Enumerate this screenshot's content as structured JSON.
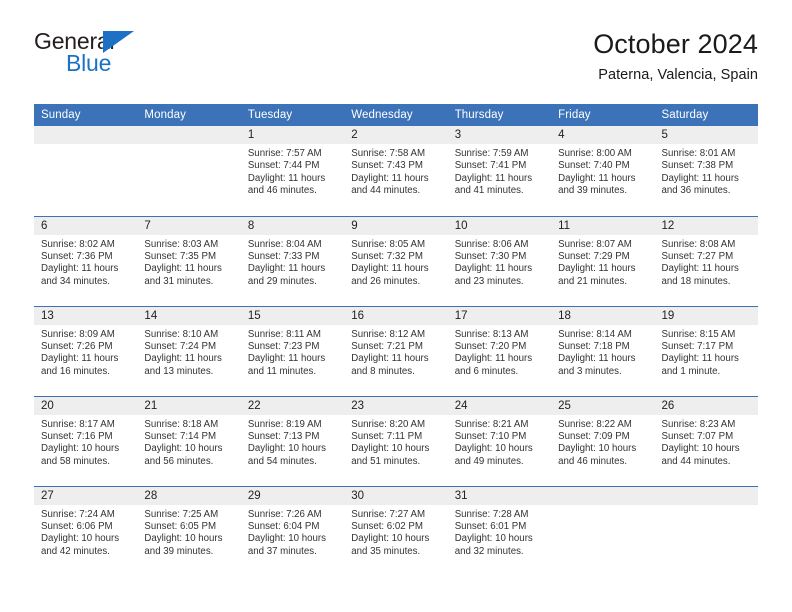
{
  "logo": {
    "word_primary": "General",
    "word_secondary": "Blue",
    "primary_color": "#231f20",
    "secondary_color": "#1c71c4"
  },
  "header": {
    "title": "October 2024",
    "subtitle": "Paterna, Valencia, Spain"
  },
  "theme": {
    "header_blue": "#3b72b8",
    "daynum_band": "#eeeeee",
    "text": "#333333"
  },
  "calendar": {
    "weekday_headers": [
      "Sunday",
      "Monday",
      "Tuesday",
      "Wednesday",
      "Thursday",
      "Friday",
      "Saturday"
    ],
    "weeks": [
      [
        {
          "day": "",
          "blank": true
        },
        {
          "day": "",
          "blank": true
        },
        {
          "day": "1",
          "sunrise": "Sunrise: 7:57 AM",
          "sunset": "Sunset: 7:44 PM",
          "daylight1": "Daylight: 11 hours",
          "daylight2": "and 46 minutes."
        },
        {
          "day": "2",
          "sunrise": "Sunrise: 7:58 AM",
          "sunset": "Sunset: 7:43 PM",
          "daylight1": "Daylight: 11 hours",
          "daylight2": "and 44 minutes."
        },
        {
          "day": "3",
          "sunrise": "Sunrise: 7:59 AM",
          "sunset": "Sunset: 7:41 PM",
          "daylight1": "Daylight: 11 hours",
          "daylight2": "and 41 minutes."
        },
        {
          "day": "4",
          "sunrise": "Sunrise: 8:00 AM",
          "sunset": "Sunset: 7:40 PM",
          "daylight1": "Daylight: 11 hours",
          "daylight2": "and 39 minutes."
        },
        {
          "day": "5",
          "sunrise": "Sunrise: 8:01 AM",
          "sunset": "Sunset: 7:38 PM",
          "daylight1": "Daylight: 11 hours",
          "daylight2": "and 36 minutes."
        }
      ],
      [
        {
          "day": "6",
          "sunrise": "Sunrise: 8:02 AM",
          "sunset": "Sunset: 7:36 PM",
          "daylight1": "Daylight: 11 hours",
          "daylight2": "and 34 minutes."
        },
        {
          "day": "7",
          "sunrise": "Sunrise: 8:03 AM",
          "sunset": "Sunset: 7:35 PM",
          "daylight1": "Daylight: 11 hours",
          "daylight2": "and 31 minutes."
        },
        {
          "day": "8",
          "sunrise": "Sunrise: 8:04 AM",
          "sunset": "Sunset: 7:33 PM",
          "daylight1": "Daylight: 11 hours",
          "daylight2": "and 29 minutes."
        },
        {
          "day": "9",
          "sunrise": "Sunrise: 8:05 AM",
          "sunset": "Sunset: 7:32 PM",
          "daylight1": "Daylight: 11 hours",
          "daylight2": "and 26 minutes."
        },
        {
          "day": "10",
          "sunrise": "Sunrise: 8:06 AM",
          "sunset": "Sunset: 7:30 PM",
          "daylight1": "Daylight: 11 hours",
          "daylight2": "and 23 minutes."
        },
        {
          "day": "11",
          "sunrise": "Sunrise: 8:07 AM",
          "sunset": "Sunset: 7:29 PM",
          "daylight1": "Daylight: 11 hours",
          "daylight2": "and 21 minutes."
        },
        {
          "day": "12",
          "sunrise": "Sunrise: 8:08 AM",
          "sunset": "Sunset: 7:27 PM",
          "daylight1": "Daylight: 11 hours",
          "daylight2": "and 18 minutes."
        }
      ],
      [
        {
          "day": "13",
          "sunrise": "Sunrise: 8:09 AM",
          "sunset": "Sunset: 7:26 PM",
          "daylight1": "Daylight: 11 hours",
          "daylight2": "and 16 minutes."
        },
        {
          "day": "14",
          "sunrise": "Sunrise: 8:10 AM",
          "sunset": "Sunset: 7:24 PM",
          "daylight1": "Daylight: 11 hours",
          "daylight2": "and 13 minutes."
        },
        {
          "day": "15",
          "sunrise": "Sunrise: 8:11 AM",
          "sunset": "Sunset: 7:23 PM",
          "daylight1": "Daylight: 11 hours",
          "daylight2": "and 11 minutes."
        },
        {
          "day": "16",
          "sunrise": "Sunrise: 8:12 AM",
          "sunset": "Sunset: 7:21 PM",
          "daylight1": "Daylight: 11 hours",
          "daylight2": "and 8 minutes."
        },
        {
          "day": "17",
          "sunrise": "Sunrise: 8:13 AM",
          "sunset": "Sunset: 7:20 PM",
          "daylight1": "Daylight: 11 hours",
          "daylight2": "and 6 minutes."
        },
        {
          "day": "18",
          "sunrise": "Sunrise: 8:14 AM",
          "sunset": "Sunset: 7:18 PM",
          "daylight1": "Daylight: 11 hours",
          "daylight2": "and 3 minutes."
        },
        {
          "day": "19",
          "sunrise": "Sunrise: 8:15 AM",
          "sunset": "Sunset: 7:17 PM",
          "daylight1": "Daylight: 11 hours",
          "daylight2": "and 1 minute."
        }
      ],
      [
        {
          "day": "20",
          "sunrise": "Sunrise: 8:17 AM",
          "sunset": "Sunset: 7:16 PM",
          "daylight1": "Daylight: 10 hours",
          "daylight2": "and 58 minutes."
        },
        {
          "day": "21",
          "sunrise": "Sunrise: 8:18 AM",
          "sunset": "Sunset: 7:14 PM",
          "daylight1": "Daylight: 10 hours",
          "daylight2": "and 56 minutes."
        },
        {
          "day": "22",
          "sunrise": "Sunrise: 8:19 AM",
          "sunset": "Sunset: 7:13 PM",
          "daylight1": "Daylight: 10 hours",
          "daylight2": "and 54 minutes."
        },
        {
          "day": "23",
          "sunrise": "Sunrise: 8:20 AM",
          "sunset": "Sunset: 7:11 PM",
          "daylight1": "Daylight: 10 hours",
          "daylight2": "and 51 minutes."
        },
        {
          "day": "24",
          "sunrise": "Sunrise: 8:21 AM",
          "sunset": "Sunset: 7:10 PM",
          "daylight1": "Daylight: 10 hours",
          "daylight2": "and 49 minutes."
        },
        {
          "day": "25",
          "sunrise": "Sunrise: 8:22 AM",
          "sunset": "Sunset: 7:09 PM",
          "daylight1": "Daylight: 10 hours",
          "daylight2": "and 46 minutes."
        },
        {
          "day": "26",
          "sunrise": "Sunrise: 8:23 AM",
          "sunset": "Sunset: 7:07 PM",
          "daylight1": "Daylight: 10 hours",
          "daylight2": "and 44 minutes."
        }
      ],
      [
        {
          "day": "27",
          "sunrise": "Sunrise: 7:24 AM",
          "sunset": "Sunset: 6:06 PM",
          "daylight1": "Daylight: 10 hours",
          "daylight2": "and 42 minutes."
        },
        {
          "day": "28",
          "sunrise": "Sunrise: 7:25 AM",
          "sunset": "Sunset: 6:05 PM",
          "daylight1": "Daylight: 10 hours",
          "daylight2": "and 39 minutes."
        },
        {
          "day": "29",
          "sunrise": "Sunrise: 7:26 AM",
          "sunset": "Sunset: 6:04 PM",
          "daylight1": "Daylight: 10 hours",
          "daylight2": "and 37 minutes."
        },
        {
          "day": "30",
          "sunrise": "Sunrise: 7:27 AM",
          "sunset": "Sunset: 6:02 PM",
          "daylight1": "Daylight: 10 hours",
          "daylight2": "and 35 minutes."
        },
        {
          "day": "31",
          "sunrise": "Sunrise: 7:28 AM",
          "sunset": "Sunset: 6:01 PM",
          "daylight1": "Daylight: 10 hours",
          "daylight2": "and 32 minutes."
        },
        {
          "day": "",
          "blank": true
        },
        {
          "day": "",
          "blank": true
        }
      ]
    ]
  }
}
